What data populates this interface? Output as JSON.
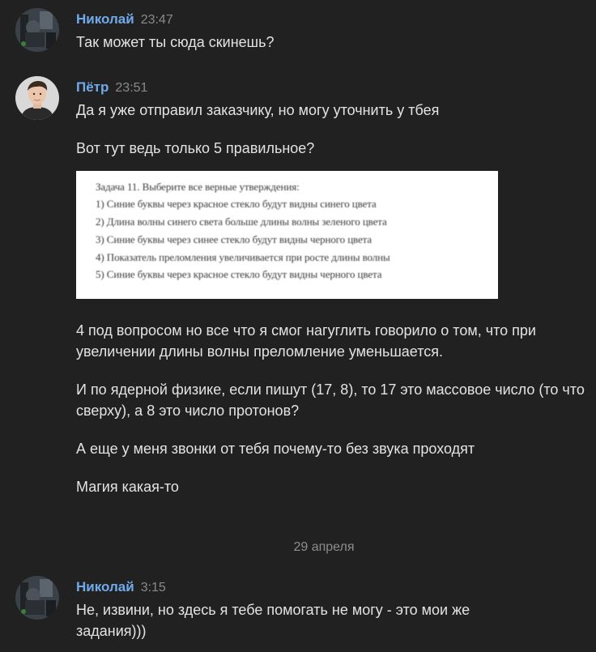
{
  "colors": {
    "background": "#212121",
    "author_name": "#71aaeb",
    "time": "#8a8a8a",
    "message_text": "#e3e3e3",
    "date_separator": "#8d8d8d"
  },
  "messages": [
    {
      "author": "Николай",
      "time": "23:47",
      "avatar_icon": "avatar-nikolai",
      "texts": [
        "Так может ты сюда скинешь?"
      ]
    },
    {
      "author": "Пётр",
      "time": "23:51",
      "avatar_icon": "avatar-petr",
      "texts": [
        "Да я уже отправил заказчику, но могу уточнить у тбея",
        "Вот тут ведь только 5 правильное?",
        "4 под вопросом но все что я смог нагуглить говорило о том, что при увеличении длины волны преломление уменьшается.",
        "И по ядерной физике, если пишут (17, 8), то 17 это массовое число (то что сверху), а 8 это число протонов?",
        "А еще у меня звонки от тебя почему-то без звука проходят",
        "Магия какая-то"
      ],
      "attachment": {
        "lines": [
          "Задача 11. Выберите все верные утверждения:",
          "1) Синие буквы через красное стекло будут видны синего цвета",
          "2) Длина волны синего света больше длины волны зеленого цвета",
          "3) Синие буквы через синее стекло будут видны черного цвета",
          "4) Показатель преломления увеличивается при росте длины волны",
          "5) Синие буквы через красное стекло будут видны черного цвета"
        ]
      }
    },
    {
      "author": "Николай",
      "time": "3:15",
      "avatar_icon": "avatar-nikolai",
      "texts": [
        "Не, извини, но здесь я тебе помогать не могу - это мои же задания)))"
      ]
    }
  ],
  "date_separator": "29 апреля"
}
